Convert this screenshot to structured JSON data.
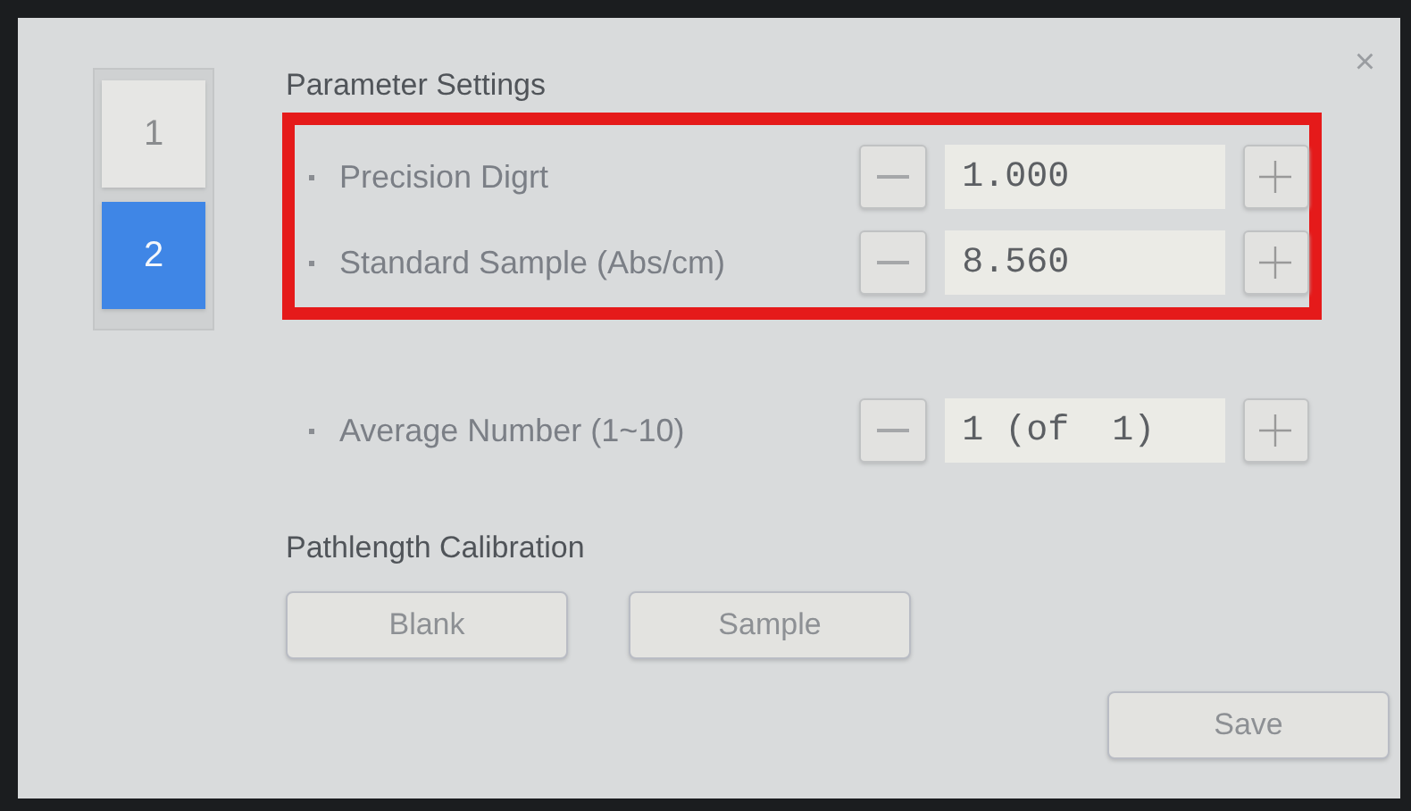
{
  "tabs": [
    {
      "label": "1",
      "selected": false
    },
    {
      "label": "2",
      "selected": true
    }
  ],
  "title": "Parameter Settings",
  "close": "×",
  "groups": [
    {
      "highlighted": true,
      "rows": [
        {
          "label": "Precision Digrt",
          "value": "1.000"
        },
        {
          "label": "Standard Sample (Abs/cm)",
          "value": "8.560"
        }
      ]
    },
    {
      "highlighted": false,
      "rows": [
        {
          "label": "Average Number (1~10)",
          "value": "1 (of  1)"
        }
      ]
    }
  ],
  "calibration": {
    "title": "Pathlength Calibration",
    "buttons": [
      "Blank",
      "Sample"
    ]
  },
  "save": "Save"
}
